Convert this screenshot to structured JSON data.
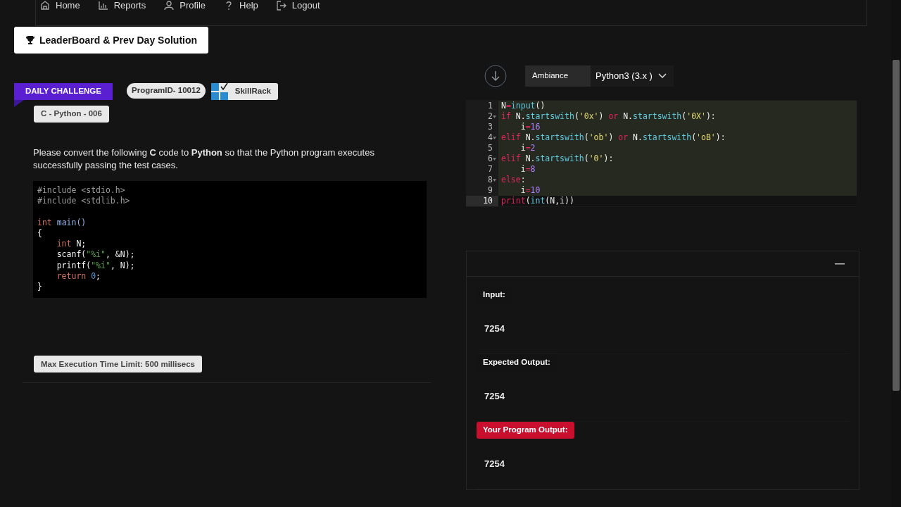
{
  "nav": [
    "Home",
    "Reports",
    "Profile",
    "Help",
    "Logout"
  ],
  "leaderboard_button": "LeaderBoard & Prev Day Solution",
  "ribbon": "DAILY CHALLENGE",
  "program_id": "ProgramID- 10012",
  "brand": "SkillRack",
  "challenge_tag": "C - Python - 006",
  "description": "Please convert the following **C** code to **Python** so that the Python program executes successfully passing the test cases.",
  "c_code": [
    {
      "kind": "code",
      "tokens": [
        {
          "text": "#include <stdio.h>",
          "kind": "pre"
        }
      ]
    },
    {
      "kind": "code",
      "tokens": [
        {
          "text": "#include <stdlib.h>",
          "kind": "pre"
        }
      ]
    },
    {
      "kind": "blank"
    },
    {
      "kind": "code",
      "tokens": [
        {
          "text": "int",
          "kind": "ckw"
        },
        {
          "text": " main()",
          "kind": "cfn"
        }
      ]
    },
    {
      "kind": "code",
      "tokens": [
        {
          "text": "{",
          "kind": "plain"
        }
      ]
    },
    {
      "kind": "code",
      "tokens": [
        {
          "text": "    int",
          "kind": "ckw"
        },
        {
          "text": " N;",
          "kind": "plain"
        }
      ]
    },
    {
      "kind": "code",
      "tokens": [
        {
          "text": "    scanf(",
          "kind": "plain"
        },
        {
          "text": "\"%i\"",
          "kind": "cstr"
        },
        {
          "text": ", &N);",
          "kind": "plain"
        }
      ]
    },
    {
      "kind": "code",
      "tokens": [
        {
          "text": "    printf(",
          "kind": "plain"
        },
        {
          "text": "\"%i\"",
          "kind": "cstr"
        },
        {
          "text": ", N);",
          "kind": "plain"
        }
      ]
    },
    {
      "kind": "code",
      "tokens": [
        {
          "text": "    return",
          "kind": "ckw"
        },
        {
          "text": " 0",
          "kind": "cnum"
        },
        {
          "text": ";",
          "kind": "plain"
        }
      ]
    },
    {
      "kind": "code",
      "tokens": [
        {
          "text": "}",
          "kind": "plain"
        }
      ]
    }
  ],
  "time_limit": "Max Execution Time Limit: 500 millisecs",
  "editor": {
    "theme_label": "Ambiance",
    "language": "Python3 (3.x )",
    "lines": [
      {
        "number": "1",
        "fold": false,
        "highlighted": true,
        "tokens": [
          {
            "text": "N",
            "kind": "plain"
          },
          {
            "text": "=",
            "kind": "op"
          },
          {
            "text": "input",
            "kind": "fn"
          },
          {
            "text": "()",
            "kind": "plain"
          }
        ]
      },
      {
        "number": "2",
        "fold": true,
        "highlighted": true,
        "tokens": [
          {
            "text": "if",
            "kind": "kw"
          },
          {
            "text": " N.",
            "kind": "plain"
          },
          {
            "text": "startswith",
            "kind": "fn"
          },
          {
            "text": "(",
            "kind": "plain"
          },
          {
            "text": "'0x'",
            "kind": "str"
          },
          {
            "text": ")",
            "kind": "plain"
          },
          {
            "text": " or",
            "kind": "kw"
          },
          {
            "text": " N.",
            "kind": "plain"
          },
          {
            "text": "startswith",
            "kind": "fn"
          },
          {
            "text": "(",
            "kind": "plain"
          },
          {
            "text": "'0X'",
            "kind": "str"
          },
          {
            "text": "):",
            "kind": "plain"
          }
        ]
      },
      {
        "number": "3",
        "fold": false,
        "highlighted": true,
        "tokens": [
          {
            "text": "    i",
            "kind": "plain"
          },
          {
            "text": "=",
            "kind": "op"
          },
          {
            "text": "16",
            "kind": "num"
          }
        ]
      },
      {
        "number": "4",
        "fold": true,
        "highlighted": true,
        "tokens": [
          {
            "text": "elif",
            "kind": "kw"
          },
          {
            "text": " N.",
            "kind": "plain"
          },
          {
            "text": "startswith",
            "kind": "fn"
          },
          {
            "text": "(",
            "kind": "plain"
          },
          {
            "text": "'ob'",
            "kind": "str"
          },
          {
            "text": ")",
            "kind": "plain"
          },
          {
            "text": " or",
            "kind": "kw"
          },
          {
            "text": " N.",
            "kind": "plain"
          },
          {
            "text": "startswith",
            "kind": "fn"
          },
          {
            "text": "(",
            "kind": "plain"
          },
          {
            "text": "'oB'",
            "kind": "str"
          },
          {
            "text": "):",
            "kind": "plain"
          }
        ]
      },
      {
        "number": "5",
        "fold": false,
        "highlighted": true,
        "tokens": [
          {
            "text": "    i",
            "kind": "plain"
          },
          {
            "text": "=",
            "kind": "op"
          },
          {
            "text": "2",
            "kind": "num"
          }
        ]
      },
      {
        "number": "6",
        "fold": true,
        "highlighted": true,
        "tokens": [
          {
            "text": "elif",
            "kind": "kw"
          },
          {
            "text": " N.",
            "kind": "plain"
          },
          {
            "text": "startswith",
            "kind": "fn"
          },
          {
            "text": "(",
            "kind": "plain"
          },
          {
            "text": "'0'",
            "kind": "str"
          },
          {
            "text": "):",
            "kind": "plain"
          }
        ]
      },
      {
        "number": "7",
        "fold": false,
        "highlighted": true,
        "tokens": [
          {
            "text": "    i",
            "kind": "plain"
          },
          {
            "text": "=",
            "kind": "op"
          },
          {
            "text": "8",
            "kind": "num"
          }
        ]
      },
      {
        "number": "8",
        "fold": true,
        "highlighted": true,
        "tokens": [
          {
            "text": "else",
            "kind": "kw"
          },
          {
            "text": ":",
            "kind": "plain"
          }
        ]
      },
      {
        "number": "9",
        "fold": false,
        "highlighted": true,
        "tokens": [
          {
            "text": "    i",
            "kind": "plain"
          },
          {
            "text": "=",
            "kind": "op"
          },
          {
            "text": "10",
            "kind": "num"
          }
        ]
      },
      {
        "number": "10",
        "fold": false,
        "highlighted": false,
        "tokens": [
          {
            "text": "print",
            "kind": "kw"
          },
          {
            "text": "(",
            "kind": "plain"
          },
          {
            "text": "int",
            "kind": "fn"
          },
          {
            "text": "(N,i))",
            "kind": "plain"
          }
        ]
      }
    ]
  },
  "results": [
    {
      "label": "Input:",
      "value": "7254",
      "kind": "plain"
    },
    {
      "label": "Expected Output:",
      "value": "7254",
      "kind": "plain"
    },
    {
      "label": "Your Program Output:",
      "value": "7254",
      "kind": "error"
    }
  ]
}
